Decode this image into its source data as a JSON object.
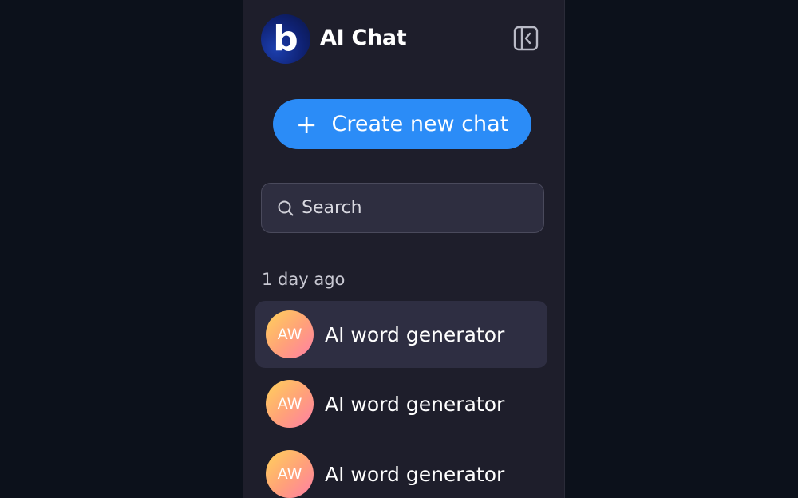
{
  "app": {
    "logo_letter": "b",
    "title": "AI Chat"
  },
  "header": {
    "collapse_icon": "sidebar-collapse-icon"
  },
  "actions": {
    "new_chat_label": "Create new chat",
    "new_chat_icon": "plus-icon",
    "accent_color": "#2b8cf7"
  },
  "search": {
    "placeholder": "Search",
    "value": "",
    "icon": "search-icon"
  },
  "history": {
    "group_label": "1 day ago",
    "items": [
      {
        "initials": "AW",
        "title": "AI word generator",
        "active": true
      },
      {
        "initials": "AW",
        "title": "AI word generator",
        "active": false
      },
      {
        "initials": "AW",
        "title": "AI word generator",
        "active": false
      }
    ]
  }
}
